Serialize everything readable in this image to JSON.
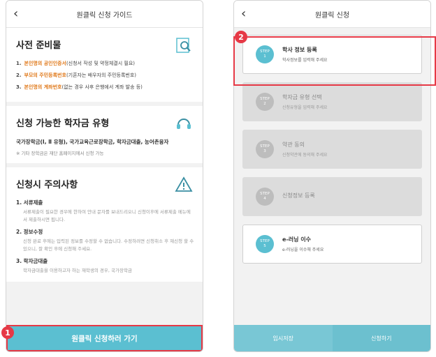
{
  "left_phone": {
    "title": "원클릭 신청 가이드",
    "back_icon": "‹",
    "prep": {
      "title": "사전 준비물",
      "items": [
        {
          "num": "1.",
          "bold": "본인명의 공인인증서",
          "rest": "(신청서 작성 및 약정체결시 필요)"
        },
        {
          "num": "2.",
          "bold": "부모의 주민등록번호",
          "rest": "(기혼자는 배우자의 주민등록번호)"
        },
        {
          "num": "3.",
          "bold": "본인명의 계좌번호",
          "rest": "(없는 경우 사후 은행에서 계좌 발송 등)"
        }
      ]
    },
    "types": {
      "title": "신청 가능한 학자금 유형",
      "list": "국가장학금(Ⅰ, Ⅱ 유형), 국가교육근로장학금, 학자금대출, 농어촌융자",
      "note": "※ 기타 장학금은 재단 홈페이지에서 신청 가능"
    },
    "caution": {
      "title": "신청시 주의사항",
      "items": [
        {
          "title": "1. 서류제출",
          "body": "서류제출이 필요한 경우에 한하여 안내 문자를 보내드리오니 신청이후에 서류제출 메뉴에서 제출하시면 됩니다."
        },
        {
          "title": "2. 정보수정",
          "body": "신청 완료 후에는 입력된 정보를 수정할 수 없습니다. 수정하려면 신청취소 후 재신청 할 수 있으니, 잘 확인 후에 신청해 주세요."
        },
        {
          "title": "3. 학자금대출",
          "body": "학자금대출을 이용하고자 하는 재학생의 경우, 국가장학금"
        }
      ]
    },
    "button": "원클릭 신청하러 가기"
  },
  "right_phone": {
    "title": "원클릭 신청",
    "back_icon": "‹",
    "steps": [
      {
        "badge_top": "STEP",
        "badge_num": "1",
        "main": "학사 정보 등록",
        "sub": "학사정보를 입력해 주세요"
      },
      {
        "badge_top": "STEP",
        "badge_num": "2",
        "main": "학자금 유형 선택",
        "sub": "신청유형을 입력해 주세요"
      },
      {
        "badge_top": "STEP",
        "badge_num": "3",
        "main": "약관 동의",
        "sub": "신청약관에 동의해 주세요"
      },
      {
        "badge_top": "STEP",
        "badge_num": "4",
        "main": "신청정보 등록",
        "sub": ""
      },
      {
        "badge_top": "STEP",
        "badge_num": "5",
        "main": "e-러닝 이수",
        "sub": "e-러닝을 이수해 주세요"
      }
    ],
    "btn_left": "임시저장",
    "btn_right": "신청하기"
  },
  "markers": {
    "one": "1",
    "two": "2"
  },
  "colors": {
    "accent": "#5bbfd1",
    "highlight": "#e63946"
  }
}
